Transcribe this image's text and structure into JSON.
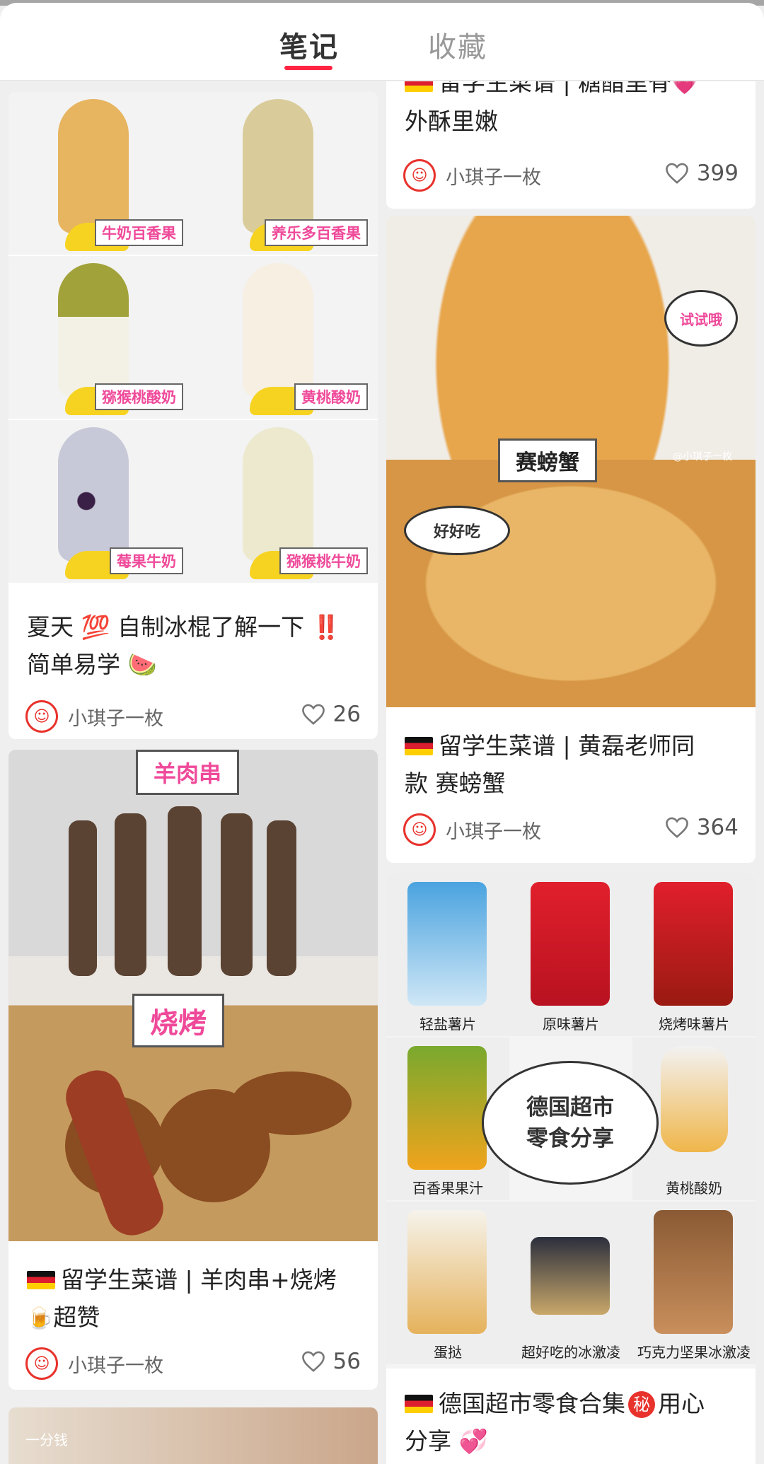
{
  "tabs": [
    {
      "label": "笔记",
      "active": true
    },
    {
      "label": "收藏",
      "active": false
    }
  ],
  "cards": {
    "ribs": {
      "title_line1": "留学生菜谱 | 糖醋里脊",
      "title_line2": "外酥里嫩",
      "author": "小琪子一枚",
      "likes": "399"
    },
    "popsicle": {
      "labels": [
        "牛奶百香果",
        "养乐多百香果",
        "猕猴桃酸奶",
        "黄桃酸奶",
        "莓果牛奶",
        "猕猴桃牛奶"
      ],
      "title_line1": "夏天 💯 自制冰棍了解一下 ‼️",
      "title_line2": "简单易学 🍉",
      "author": "小琪子一枚",
      "likes": "26"
    },
    "crab": {
      "label_main": "赛螃蟹",
      "bubble_top": "试试哦",
      "bubble_left": "好好吃",
      "watermark": "@小琪子一枚",
      "title_line1": "留学生菜谱 | 黄磊老师同",
      "title_line2": "款 赛螃蟹",
      "author": "小琪子一枚",
      "likes": "364"
    },
    "bbq": {
      "label_top": "羊肉串",
      "label_mid": "烧烤",
      "title_line1": "留学生菜谱 | 羊肉串+烧烤",
      "title_line2": "超赞",
      "author": "小琪子一枚",
      "likes": "56"
    },
    "snacks": {
      "captions": [
        "轻盐薯片",
        "原味薯片",
        "烧烤味薯片",
        "百香果果汁",
        "黄桃酸奶",
        "蛋挞",
        "超好吃的冰激凌",
        "巧克力坚果冰激凌"
      ],
      "bubble_line1": "德国超市",
      "bubble_line2": "零食分享",
      "title_line1": "德国超市零食合集",
      "title_badge": "秘",
      "title_line1b": "用心",
      "title_line2": "分享 💞"
    },
    "bottom_watermark": "一分钱"
  },
  "colors": {
    "accent": "#ff2442",
    "label_pink": "#ef4a9a"
  }
}
